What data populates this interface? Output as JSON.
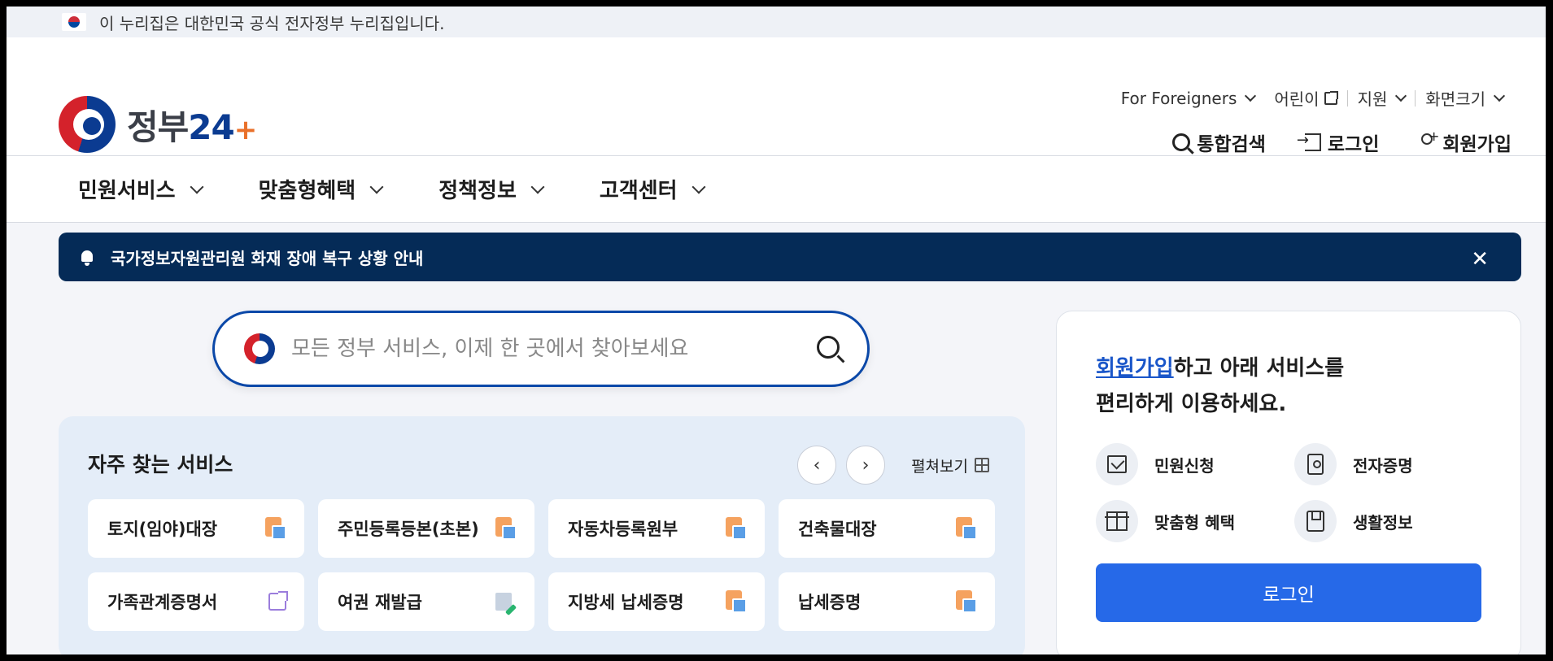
{
  "gov_banner": {
    "text": "이 누리집은 대한민국 공식 전자정부 누리집입니다."
  },
  "logo": {
    "text_main": "정부",
    "text_num": "24",
    "text_plus": "+"
  },
  "util_nav": {
    "foreigners": "For Foreigners",
    "kids": "어린이",
    "support": "지원",
    "font_size": "화면크기"
  },
  "main_actions": {
    "search": "통합검색",
    "login": "로그인",
    "signup": "회원가입"
  },
  "gnb": {
    "items": [
      {
        "label": "민원서비스"
      },
      {
        "label": "맞춤형혜택"
      },
      {
        "label": "정책정보"
      },
      {
        "label": "고객센터"
      }
    ]
  },
  "notice": {
    "text": "국가정보자원관리원 화재 장애 복구 상황 안내"
  },
  "search": {
    "placeholder": "모든 정부 서비스, 이제 한 곳에서 찾아보세요"
  },
  "frequent": {
    "title": "자주 찾는 서비스",
    "expand": "펼쳐보기",
    "cards": [
      {
        "label": "토지(임야)대장",
        "icon": "pdf-icon"
      },
      {
        "label": "주민등록등본(초본)",
        "icon": "pdf-icon"
      },
      {
        "label": "자동차등록원부",
        "icon": "pdf-icon"
      },
      {
        "label": "건축물대장",
        "icon": "pdf-icon"
      },
      {
        "label": "가족관계증명서",
        "icon": "external-link-icon"
      },
      {
        "label": "여권 재발급",
        "icon": "edit-icon"
      },
      {
        "label": "지방세 납세증명",
        "icon": "pdf-icon"
      },
      {
        "label": "납세증명",
        "icon": "pdf-icon"
      }
    ]
  },
  "panel": {
    "title_link": "회원가입",
    "title_rest1": "하고 아래 서비스를",
    "title_line2": "편리하게 이용하세요.",
    "services": [
      {
        "label": "민원신청",
        "icon": "mail-icon"
      },
      {
        "label": "전자증명",
        "icon": "certificate-icon"
      },
      {
        "label": "맞춤형 혜택",
        "icon": "gift-icon"
      },
      {
        "label": "생활정보",
        "icon": "bookmark-icon"
      }
    ],
    "login_button": "로그인"
  },
  "colors": {
    "brand_navy": "#052b57",
    "primary_blue": "#2669e8",
    "accent_orange": "#e9702a"
  }
}
